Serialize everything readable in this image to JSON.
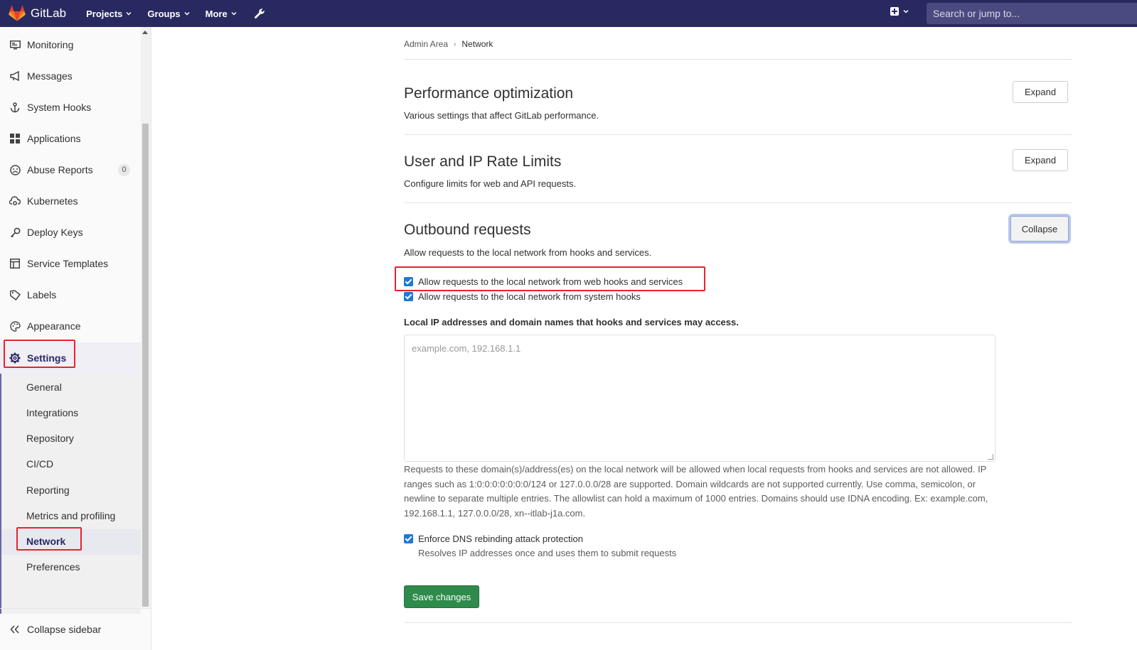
{
  "navbar": {
    "brand": "GitLab",
    "items": [
      {
        "label": "Projects"
      },
      {
        "label": "Groups"
      },
      {
        "label": "More"
      }
    ],
    "search_placeholder": "Search or jump to..."
  },
  "sidebar": {
    "items": [
      {
        "label": "Monitoring",
        "icon": "monitor-icon"
      },
      {
        "label": "Messages",
        "icon": "bullhorn-icon"
      },
      {
        "label": "System Hooks",
        "icon": "hook-icon"
      },
      {
        "label": "Applications",
        "icon": "grid-icon"
      },
      {
        "label": "Abuse Reports",
        "icon": "frown-icon",
        "badge": "0"
      },
      {
        "label": "Kubernetes",
        "icon": "cloud-gear-icon"
      },
      {
        "label": "Deploy Keys",
        "icon": "key-icon"
      },
      {
        "label": "Service Templates",
        "icon": "template-icon"
      },
      {
        "label": "Labels",
        "icon": "tag-icon"
      },
      {
        "label": "Appearance",
        "icon": "palette-icon"
      },
      {
        "label": "Settings",
        "icon": "gear-icon"
      }
    ],
    "settings_sub": [
      {
        "label": "General"
      },
      {
        "label": "Integrations"
      },
      {
        "label": "Repository"
      },
      {
        "label": "CI/CD"
      },
      {
        "label": "Reporting"
      },
      {
        "label": "Metrics and profiling"
      },
      {
        "label": "Network"
      },
      {
        "label": "Preferences"
      }
    ],
    "collapse_label": "Collapse sidebar"
  },
  "breadcrumb": {
    "parent": "Admin Area",
    "current": "Network"
  },
  "sections": {
    "performance": {
      "title": "Performance optimization",
      "description": "Various settings that affect GitLab performance.",
      "button": "Expand"
    },
    "rate_limits": {
      "title": "User and IP Rate Limits",
      "description": "Configure limits for web and API requests.",
      "button": "Expand"
    },
    "outbound": {
      "title": "Outbound requests",
      "description": "Allow requests to the local network from hooks and services.",
      "button": "Collapse",
      "checkbox_web_hooks": {
        "label": "Allow requests to the local network from web hooks and services",
        "checked": true
      },
      "checkbox_system_hooks": {
        "label": "Allow requests to the local network from system hooks",
        "checked": true
      },
      "allowlist_label": "Local IP addresses and domain names that hooks and services may access.",
      "allowlist_placeholder": "example.com, 192.168.1.1",
      "allowlist_help": "Requests to these domain(s)/address(es) on the local network will be allowed when local requests from hooks and services are not allowed. IP ranges such as 1:0:0:0:0:0:0:0/124 or 127.0.0.0/28 are supported. Domain wildcards are not supported currently. Use comma, semicolon, or newline to separate multiple entries. The allowlist can hold a maximum of 1000 entries. Domains should use IDNA encoding. Ex: example.com, 192.168.1.1, 127.0.0.0/28, xn--itlab-j1a.com.",
      "checkbox_dns": {
        "label": "Enforce DNS rebinding attack protection",
        "checked": true
      },
      "dns_help": "Resolves IP addresses once and uses them to submit requests",
      "save_label": "Save changes"
    }
  },
  "colors": {
    "navbar_bg": "#292961",
    "highlight_red": "#e8232b",
    "checkbox_blue": "#1f78d1",
    "save_green": "#2e8b4b"
  }
}
